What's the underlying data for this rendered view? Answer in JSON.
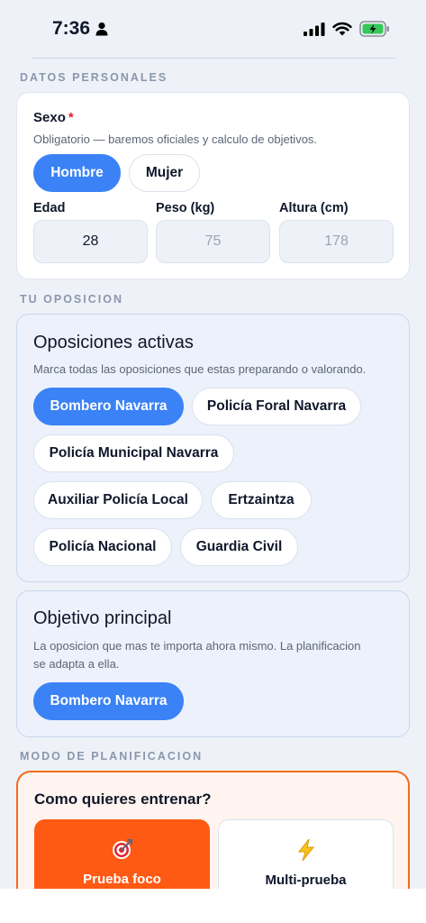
{
  "status_bar": {
    "time": "7:36"
  },
  "sections": {
    "personal": "DATOS PERSONALES",
    "opposition": "TU OPOSICION",
    "planning": "MODO DE PLANIFICACION"
  },
  "personal": {
    "sex_title": "Sexo",
    "required_mark": "*",
    "sex_hint": "Obligatorio — baremos oficiales y calculo de objetivos.",
    "sex_options": [
      {
        "label": "Hombre",
        "selected": true
      },
      {
        "label": "Mujer",
        "selected": false
      }
    ],
    "age_label": "Edad",
    "age_value": "28",
    "weight_label": "Peso (kg)",
    "weight_placeholder": "75",
    "height_label": "Altura (cm)",
    "height_placeholder": "178"
  },
  "active": {
    "title": "Oposiciones activas",
    "hint": "Marca todas las oposiciones que estas preparando o valorando.",
    "options": [
      {
        "label": "Bombero Navarra",
        "selected": true
      },
      {
        "label": "Policía Foral Navarra",
        "selected": false
      },
      {
        "label": "Policía Municipal Navarra",
        "selected": false
      },
      {
        "label": "Auxiliar Policía Local",
        "selected": false
      },
      {
        "label": "Ertzaintza",
        "selected": false
      },
      {
        "label": "Policía Nacional",
        "selected": false
      },
      {
        "label": "Guardia Civil",
        "selected": false
      }
    ]
  },
  "main_goal": {
    "title": "Objetivo principal",
    "hint_line1": "La oposicion que mas te importa ahora mismo. La planificacion",
    "hint_line2": "se adapta a ella.",
    "selected": "Bombero Navarra"
  },
  "planning": {
    "title": "Como quieres entrenar?",
    "modes": [
      {
        "label": "Prueba foco",
        "icon": "target-icon",
        "selected": true
      },
      {
        "label": "Multi-prueba",
        "icon": "lightning-icon",
        "selected": false
      }
    ]
  },
  "colors": {
    "accent_blue": "#3b82f6",
    "accent_orange": "#ff5a14",
    "required_red": "#e11d2e"
  }
}
